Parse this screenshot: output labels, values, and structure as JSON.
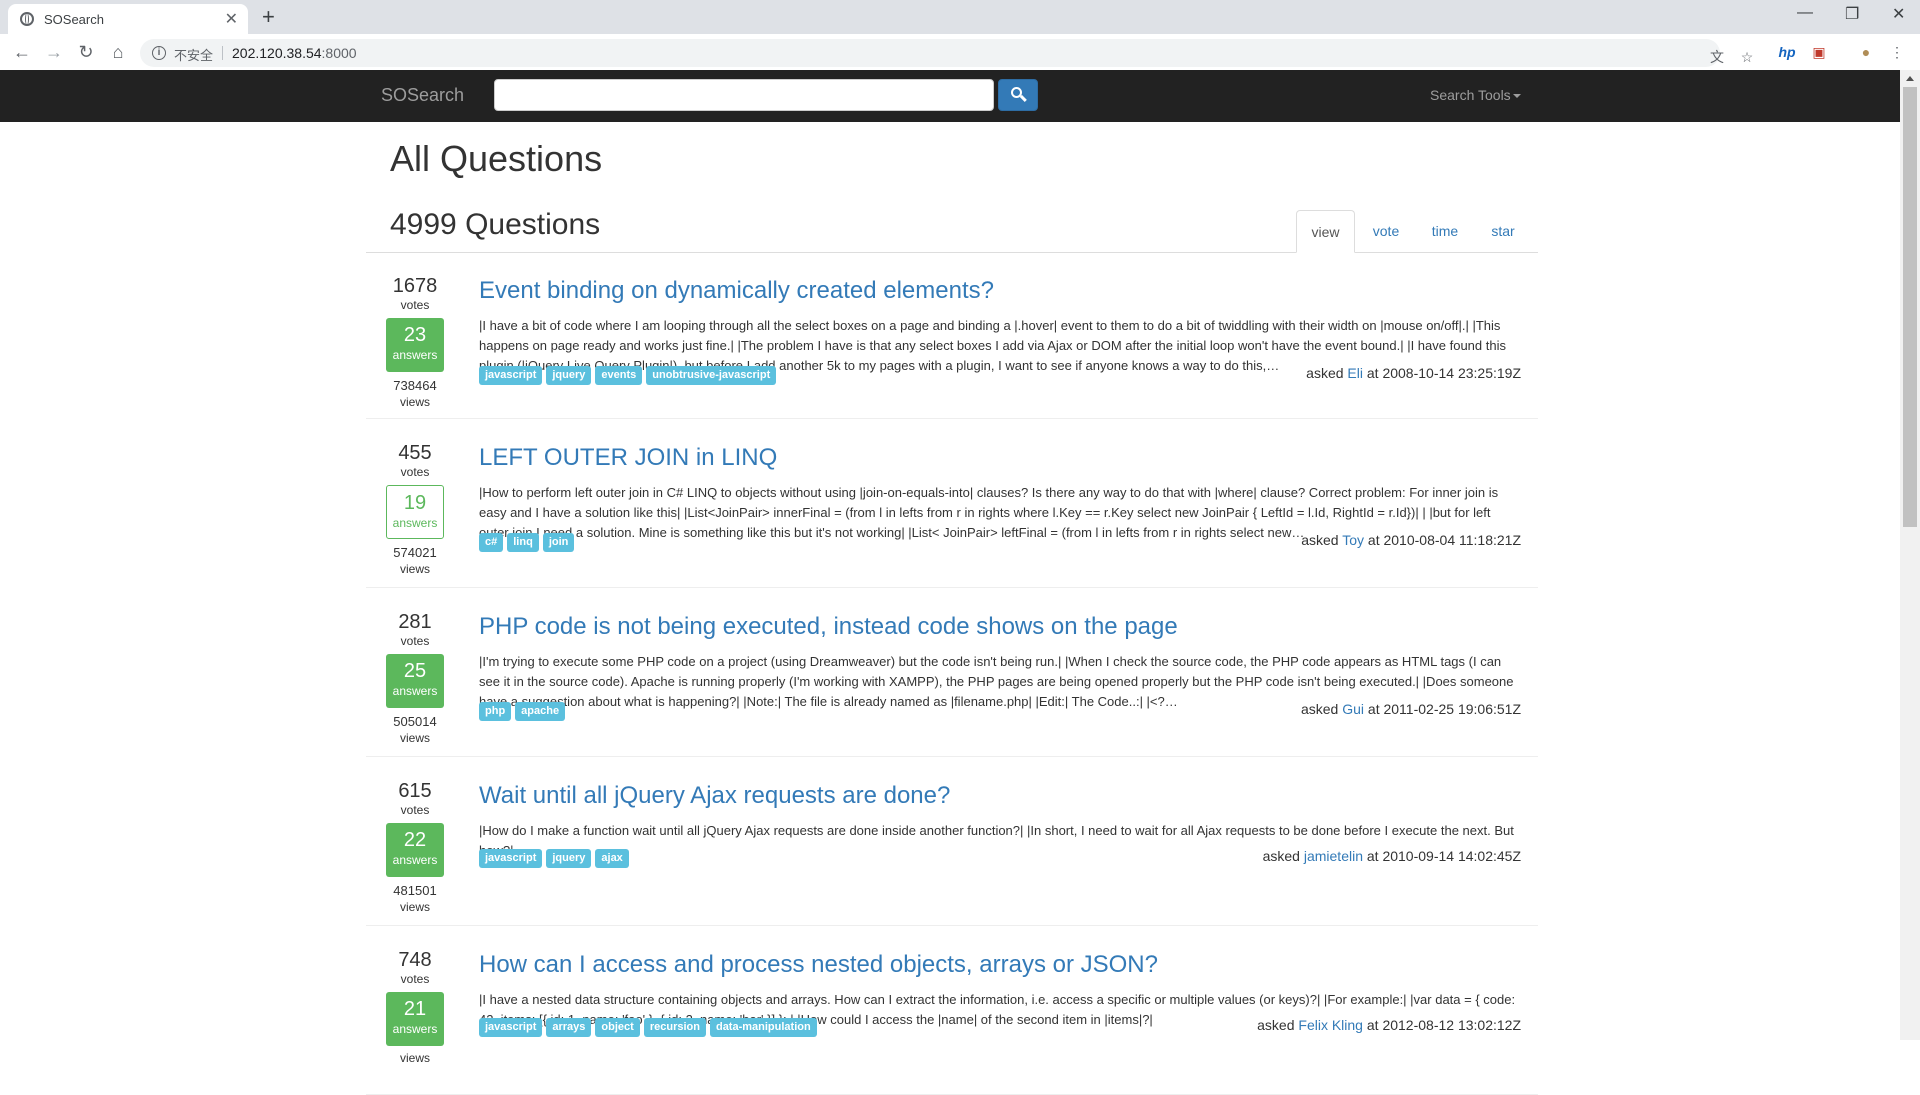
{
  "browser": {
    "tab_title": "SOSearch",
    "insecure_label": "不安全",
    "url_host": "202.120.38.54",
    "url_port": ":8000"
  },
  "navbar": {
    "brand": "SOSearch",
    "search_placeholder": "",
    "tools_label": "Search Tools"
  },
  "main": {
    "page_title": "All Questions",
    "count_title": "4999 Questions",
    "sort_tabs": [
      "view",
      "vote",
      "time",
      "star"
    ],
    "active_sort": "view"
  },
  "questions": [
    {
      "votes": "1678",
      "answers": "23",
      "views": "738464",
      "title": "Event binding on dynamically created elements?",
      "excerpt": "|I have a bit of code where I am looping through all the select boxes on a page and binding a |.hover| event to them to do a bit of twiddling with their width on |mouse on/off|.| |This happens on page ready and works just fine.| |The problem I have is that any select boxes I add via Ajax or DOM after the initial loop won't have the event bound.| |I have found this plugin (|jQuery Live Query Plugin|), but before I add another 5k to my pages with a plugin, I want to see if anyone knows a way to do this,…",
      "tags": [
        "javascript",
        "jquery",
        "events",
        "unobtrusive-javascript"
      ],
      "user": "Eli",
      "time": "at 2008-10-14 23:25:19Z"
    },
    {
      "votes": "455",
      "answers": "19",
      "views": "574021",
      "title": "LEFT OUTER JOIN in LINQ",
      "excerpt": "|How to perform left outer join in C# LINQ to objects without using |join-on-equals-into| clauses? Is there any way to do that with |where| clause? Correct problem: For inner join is easy and I have a solution like this| |List<JoinPair> innerFinal = (from l in lefts from r in rights where l.Key == r.Key select new JoinPair { LeftId = l.Id, RightId = r.Id})| | |but for left outer join I need a solution. Mine is something like this but it's not working| |List< JoinPair> leftFinal = (from l in lefts from r in rights select new…",
      "tags": [
        "c#",
        "linq",
        "join"
      ],
      "user": "Toy",
      "time": "at 2010-08-04 11:18:21Z"
    },
    {
      "votes": "281",
      "answers": "25",
      "views": "505014",
      "title": "PHP code is not being executed, instead code shows on the page",
      "excerpt": "|I'm trying to execute some PHP code on a project (using Dreamweaver) but the code isn't being run.| |When I check the source code, the PHP code appears as HTML tags (I can see it in the source code). Apache is running properly (I'm working with XAMPP), the PHP pages are being opened properly but the PHP code isn't being executed.| |Does someone have a suggestion about what is happening?| |Note:| The file is already named as |filename.php| |Edit:| The Code..:| |<?…",
      "tags": [
        "php",
        "apache"
      ],
      "user": "Gui",
      "time": "at 2011-02-25 19:06:51Z"
    },
    {
      "votes": "615",
      "answers": "22",
      "views": "481501",
      "title": "Wait until all jQuery Ajax requests are done?",
      "excerpt": "|How do I make a function wait until all jQuery Ajax requests are done inside another function?| |In short, I need to wait for all Ajax requests to be done before I execute the next. But how?|",
      "tags": [
        "javascript",
        "jquery",
        "ajax"
      ],
      "user": "jamietelin",
      "time": "at 2010-09-14 14:02:45Z"
    },
    {
      "votes": "748",
      "answers": "21",
      "views": "",
      "title": "How can I access and process nested objects, arrays or JSON?",
      "excerpt": "|I have a nested data structure containing objects and arrays. How can I extract the information, i.e. access a specific or multiple values (or keys)?| |For example:| |var data = { code: 42, items: [{ id: 1, name: 'foo' }, { id: 2, name: 'bar' }] }; | |How could I access the |name| of the second item in |items|?|",
      "tags": [
        "javascript",
        "arrays",
        "object",
        "recursion",
        "data-manipulation"
      ],
      "user": "Felix Kling",
      "time": "at 2012-08-12 13:02:12Z"
    }
  ],
  "labels": {
    "votes": "votes",
    "answers": "answers",
    "views": "views",
    "asked": "asked"
  }
}
